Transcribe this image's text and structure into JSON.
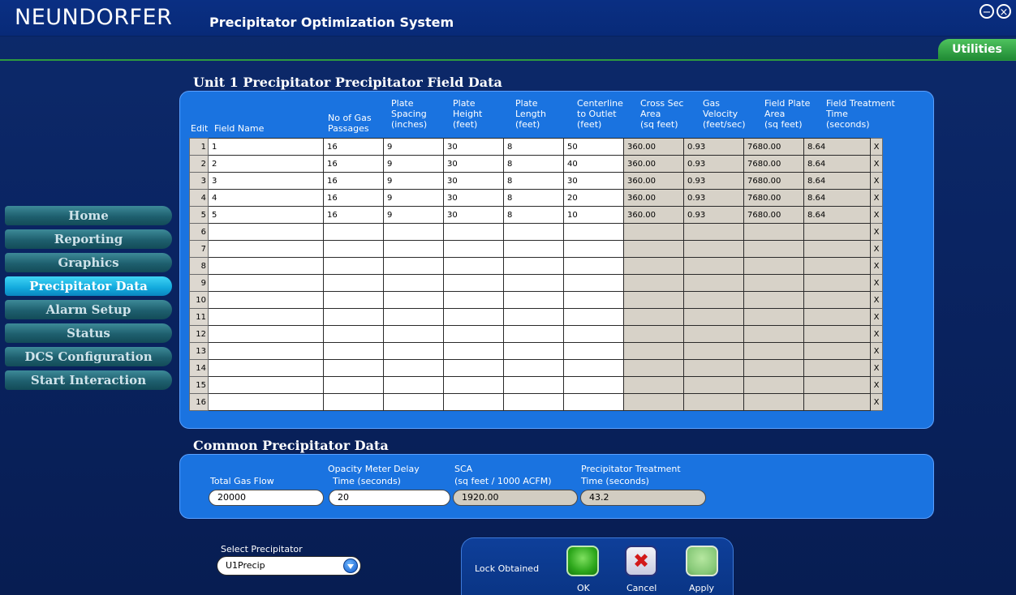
{
  "header": {
    "brand": "NEUNDORFER",
    "subtitle": "Precipitator Optimization System",
    "minimize_glyph": "−",
    "close_glyph": "×",
    "utilities": "Utilities"
  },
  "nav": {
    "items": [
      {
        "label": "Home"
      },
      {
        "label": "Reporting"
      },
      {
        "label": "Graphics"
      },
      {
        "label": "Precipitator Data",
        "active": true
      },
      {
        "label": "Alarm Setup"
      },
      {
        "label": "Status"
      },
      {
        "label": "DCS Configuration"
      },
      {
        "label": "Start Interaction"
      }
    ]
  },
  "field_data": {
    "title": "Unit 1 Precipitator Precipitator Field Data",
    "headers": {
      "edit": "Edit",
      "field_name": "Field Name",
      "gas_passages": [
        "No of Gas",
        "Passages"
      ],
      "plate_spacing": [
        "Plate",
        "Spacing",
        "(inches)"
      ],
      "plate_height": [
        "Plate",
        "Height",
        "(feet)"
      ],
      "plate_length": [
        "Plate",
        "Length",
        "(feet)"
      ],
      "centerline": [
        "Centerline",
        "to Outlet",
        "(feet)"
      ],
      "cross_sec": [
        "Cross Sec",
        "Area",
        "(sq feet)"
      ],
      "gas_velocity": [
        "Gas",
        "Velocity",
        "(feet/sec)"
      ],
      "field_plate_area": [
        "Field Plate",
        "Area",
        "(sq feet)"
      ],
      "field_treatment": [
        "Field Treatment",
        "Time",
        "(seconds)"
      ]
    },
    "delete_glyph": "X",
    "rows": [
      {
        "n": "1",
        "name": "1",
        "gas": "16",
        "spacing": "9",
        "height": "30",
        "length": "8",
        "center": "50",
        "cross": "360.00",
        "vel": "0.93",
        "area": "7680.00",
        "time": "8.64"
      },
      {
        "n": "2",
        "name": "2",
        "gas": "16",
        "spacing": "9",
        "height": "30",
        "length": "8",
        "center": "40",
        "cross": "360.00",
        "vel": "0.93",
        "area": "7680.00",
        "time": "8.64"
      },
      {
        "n": "3",
        "name": "3",
        "gas": "16",
        "spacing": "9",
        "height": "30",
        "length": "8",
        "center": "30",
        "cross": "360.00",
        "vel": "0.93",
        "area": "7680.00",
        "time": "8.64"
      },
      {
        "n": "4",
        "name": "4",
        "gas": "16",
        "spacing": "9",
        "height": "30",
        "length": "8",
        "center": "20",
        "cross": "360.00",
        "vel": "0.93",
        "area": "7680.00",
        "time": "8.64"
      },
      {
        "n": "5",
        "name": "5",
        "gas": "16",
        "spacing": "9",
        "height": "30",
        "length": "8",
        "center": "10",
        "cross": "360.00",
        "vel": "0.93",
        "area": "7680.00",
        "time": "8.64"
      },
      {
        "n": "6"
      },
      {
        "n": "7"
      },
      {
        "n": "8"
      },
      {
        "n": "9"
      },
      {
        "n": "10"
      },
      {
        "n": "11"
      },
      {
        "n": "12"
      },
      {
        "n": "13"
      },
      {
        "n": "14"
      },
      {
        "n": "15"
      },
      {
        "n": "16"
      }
    ]
  },
  "common": {
    "title": "Common Precipitator Data",
    "total_gas_flow": {
      "label": "Total Gas Flow",
      "value": "20000"
    },
    "opacity_delay": {
      "label1": "Opacity Meter Delay",
      "label2": "Time (seconds)",
      "value": "20"
    },
    "sca": {
      "label1": "SCA",
      "label2": "(sq feet / 1000 ACFM)",
      "value": "1920.00"
    },
    "treatment": {
      "label1": "Precipitator Treatment",
      "label2": "Time (seconds)",
      "value": "43.2"
    }
  },
  "select": {
    "label": "Select Precipitator",
    "value": "U1Precip"
  },
  "actions": {
    "lock_status": "Lock Obtained",
    "ok": "OK",
    "cancel": "Cancel",
    "apply": "Apply"
  }
}
